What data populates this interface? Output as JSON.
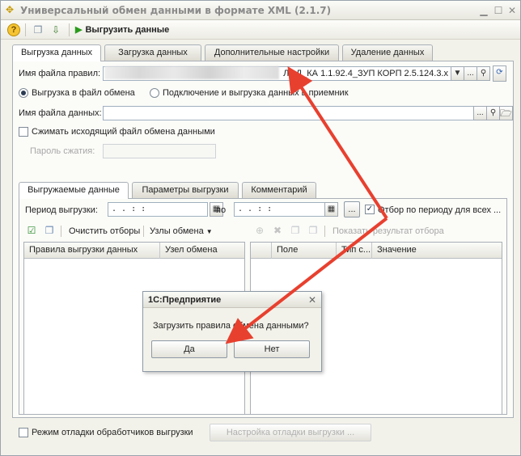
{
  "window": {
    "title": "Универсальный обмен данными в формате XML (2.1.7)"
  },
  "toolbar": {
    "export_label": "Выгрузить данные"
  },
  "main_tabs": [
    {
      "label": "Выгрузка данных"
    },
    {
      "label": "Загрузка данных"
    },
    {
      "label": "Дополнительные настройки"
    },
    {
      "label": "Удаление данных"
    }
  ],
  "rules_file": {
    "label": "Имя файла правил:",
    "value": "ЛОД_КА 1.1.92.4_ЗУП КОРП 2.5.124.3.x"
  },
  "mode": {
    "option1": "Выгрузка в файл обмена",
    "option2": "Подключение и выгрузка данных в приемник",
    "selected": "option1"
  },
  "data_file": {
    "label": "Имя файла данных:",
    "value": ""
  },
  "compress": {
    "label": "Сжимать исходящий файл обмена данными",
    "checked": false
  },
  "password": {
    "label": "Пароль сжатия:",
    "value": ""
  },
  "sub_tabs": [
    {
      "label": "Выгружаемые данные"
    },
    {
      "label": "Параметры выгрузки"
    },
    {
      "label": "Комментарий"
    }
  ],
  "period": {
    "label": "Период выгрузки:",
    "from": " .  .     :  :",
    "to_label": "по",
    "to": " .  .     :  :",
    "filter_label": "Отбор по периоду для всех ...",
    "filter_checked": true,
    "ellipsis": "..."
  },
  "left_toolbar": {
    "clear_filters": "Очистить отборы",
    "nodes": "Узлы обмена"
  },
  "left_grid": {
    "columns": [
      "Правила выгрузки данных",
      "Узел обмена"
    ]
  },
  "right_toolbar": {
    "show_filter_result": "Показать результат отбора"
  },
  "right_grid": {
    "columns": [
      "Поле",
      "Тип с...",
      "Значение"
    ]
  },
  "debug": {
    "label": "Режим отладки обработчиков выгрузки",
    "checked": false,
    "settings_button": "Настройка отладки выгрузки ..."
  },
  "dialog": {
    "title": "1С:Предприятие",
    "message": "Загрузить правила обмена данными?",
    "yes": "Да",
    "no": "Нет"
  },
  "colors": {
    "arrow": "#e8402f",
    "accent_green": "#2a9b1c"
  }
}
